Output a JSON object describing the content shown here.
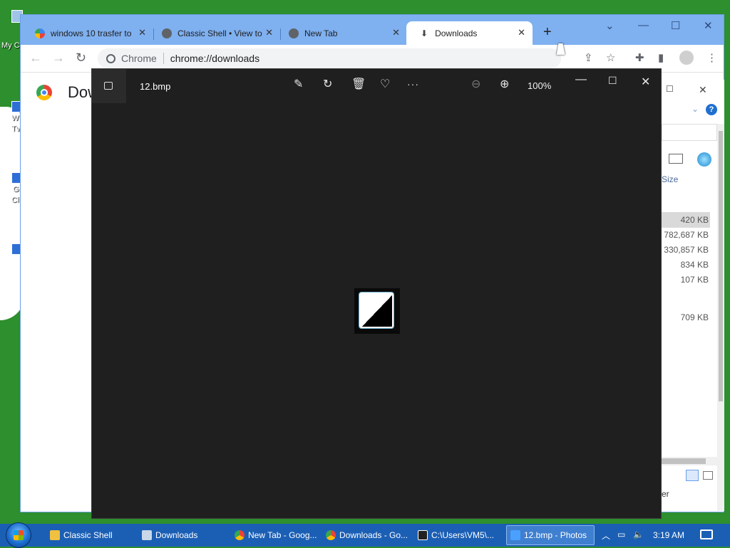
{
  "desktop": {
    "icon_labels": [
      "My C",
      "W",
      "Tv",
      "G",
      "Cl"
    ]
  },
  "chrome": {
    "tabs": [
      {
        "label": "windows 10 trasfer to",
        "icon": "google-icon"
      },
      {
        "label": "Classic Shell • View to",
        "icon": "globe-icon"
      },
      {
        "label": "New Tab",
        "icon": "chrome-icon"
      },
      {
        "label": "Downloads",
        "icon": "download-icon"
      }
    ],
    "new_tab_label": "+",
    "close_glyph": "✕",
    "omnibox": {
      "chip_label": "Chrome",
      "url": "chrome://downloads"
    },
    "page_title": "Downloads"
  },
  "explorer": {
    "column_header": "Size",
    "sizes": [
      "420 KB",
      "782,687 KB",
      "330,857 KB",
      "834 KB",
      "107 KB",
      "709 KB"
    ],
    "footer_text": "er",
    "help_label": "?"
  },
  "photos": {
    "file_name": "12.bmp",
    "zoom_level": "100%",
    "more_glyph": "···"
  },
  "taskbar": {
    "items": [
      {
        "label": "Classic Shell",
        "color": "#f0c040"
      },
      {
        "label": "Downloads",
        "color": "#c8d8e8"
      },
      {
        "label": "New Tab - Goog...",
        "color": "#e04040"
      },
      {
        "label": "Downloads - Go...",
        "color": "#e04040"
      },
      {
        "label": "C:\\Users\\VM5\\...",
        "color": "#222222"
      },
      {
        "label": "12.bmp - Photos",
        "color": "#4aa0ff"
      }
    ],
    "time": "3:19 AM"
  },
  "colors": {
    "desktop_bg": "#2d8f2d",
    "chrome_frame": "#7fb0f0",
    "photos_bg": "#1f1f1f",
    "taskbar_bg": "#1b5fb5"
  }
}
